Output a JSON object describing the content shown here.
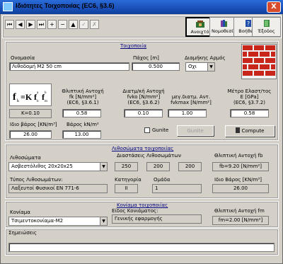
{
  "window": {
    "title": "Ιδιότητες Τοιχοποιίας (EC6, §3.6)",
    "close_label": "X"
  },
  "toolbar": {
    "nav_buttons": [
      "⏮",
      "◀",
      "▶",
      "⏭",
      "+",
      "−",
      "▲",
      "✓",
      "✗"
    ],
    "open_label": "Ανοιχτό",
    "standards_label": "Νομοθεσία",
    "help_label": "Βοήθεια",
    "exit_label": "Έξοδος"
  },
  "wall": {
    "section_title": "Τοιχοποιία",
    "name_label": "Ονομασία",
    "name_value": "Λιθοδομή M2 50 cm",
    "thickness_label": "Πάχος [m]",
    "thickness_value": "0.500",
    "joint_label": "Διαμήκης Αρμός",
    "joint_value": "Οχι"
  },
  "formula": {
    "main": "f",
    "text": "fk=K fb^a fm^b",
    "k_value": "K=0.10"
  },
  "props": {
    "fk_label_1": "Θλιπτική Αντοχή",
    "fk_label_2": "fk [N/mm²]",
    "fk_label_3": "(EC6, §3.6.1)",
    "fk_value": "0.58",
    "fvko_label_1": "Διατμ/κή Αντοχή",
    "fvko_label_2": "fvko [N/mm²]",
    "fvko_label_3": "(EC6, §3.6.2)",
    "fvko_value": "0.10",
    "fvkmax_label_1": "μεγ.διατμ. Αντ.",
    "fvkmax_label_2": "fvkmax [N/mm²]",
    "fvkmax_value": "1.00",
    "e_label_1": "Μέτρο Ελαστ/τος",
    "e_label_2": "E [GPa]",
    "e_label_3": "(EC6, §3.7.2)",
    "e_value": "0.58",
    "weight_label": "Ιδιο βάρος [KN/m³]",
    "weight_value": "26.00",
    "weight2_label": "Βάρος kN/m²",
    "weight2_value": "13.00",
    "gunite_check_label": "Gunite",
    "gunite_button": "Gunite",
    "compute_button": "Compute"
  },
  "units": {
    "section_title": "Λιθοσώματα τοιχοποιίας",
    "label": "Λιθοσώματα",
    "value": "Ασβεστόλιθος 20x20x25",
    "dims_label": "Διαστάσεις Λιθοσωμάτων",
    "dims": [
      "250",
      "200",
      "200"
    ],
    "fb_label": "Θλιπτική Αντοχή fb",
    "fb_value": "fb=9.20  [N/mm²]",
    "type_label": "Τύπος Λιθοσωμάτων:",
    "type_value": "Λαξευτοί Φυσικοί  EN 771-6",
    "category_label": "Κατηγορία",
    "category_value": "II",
    "group_label": "Ομάδα",
    "group_value": "1",
    "density_label": "Ιδιο Βάρος [KN/m³]",
    "density_value": "26.00"
  },
  "mortar": {
    "section_title": "Κονίαμα τοιχοποιίας",
    "label": "Κονίαμα",
    "value": "Τσιμεντοκονίαμα-M2",
    "kind_label": "Είδος Κονιάματος:",
    "kind_value": "Γενικής εφαρμογής",
    "fm_label": "Θλιπτική Αντοχή fm",
    "fm_value": "fm=2.00  [N/mm²]"
  },
  "notes": {
    "label": "Σημειώσεις",
    "value": ""
  },
  "colors": {
    "brick": "#c8261a",
    "mortar": "#f0f0f0",
    "title_bar": "#1a4fb8",
    "link_blue": "#000080"
  }
}
